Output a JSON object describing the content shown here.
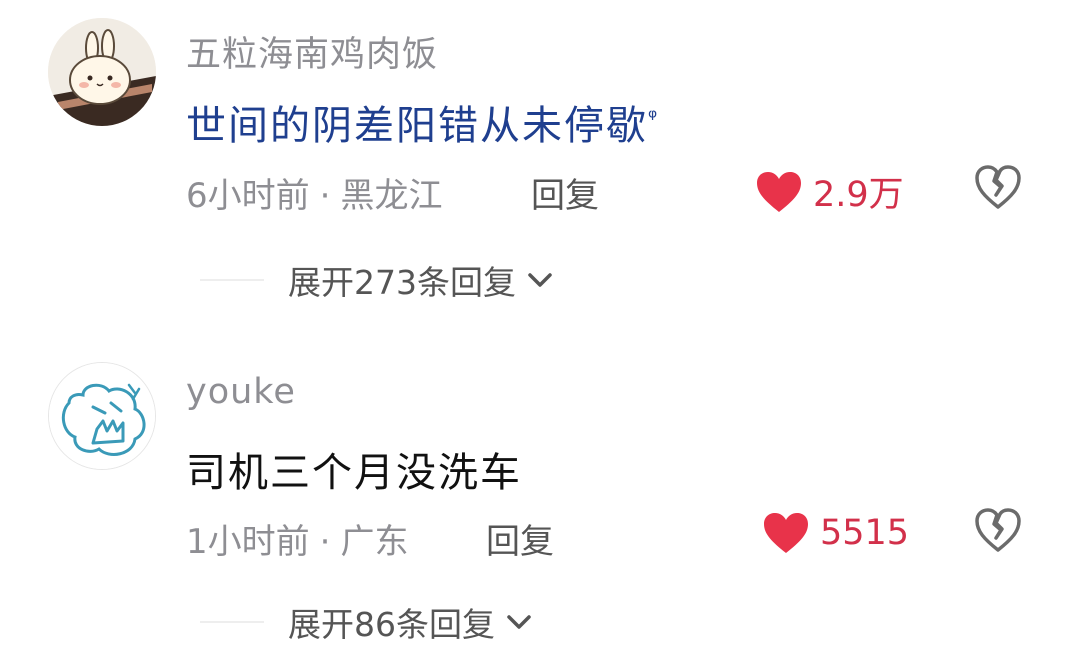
{
  "comments": [
    {
      "username": "五粒海南鸡肉饭",
      "text": "世间的阴差阳错从未停歇",
      "search_glyph": "ᵠ",
      "time": "6小时前",
      "separator": "·",
      "location": "黑龙江",
      "reply_label": "回复",
      "likes": "2.9万",
      "expand_label": "展开273条回复",
      "avatar_icon": "bunny-avatar-icon",
      "text_color": "#1f3f8f"
    },
    {
      "username": "youke",
      "text": "司机三个月没洗车",
      "time": "1小时前",
      "separator": "·",
      "location": "广东",
      "reply_label": "回复",
      "likes": "5515",
      "expand_label": "展开86条回复",
      "avatar_icon": "doodle-avatar-icon",
      "text_color": "#111111"
    }
  ],
  "colors": {
    "like_red": "#d2304a",
    "muted_gray": "#8e8e93",
    "link_blue": "#1f3f8f"
  }
}
